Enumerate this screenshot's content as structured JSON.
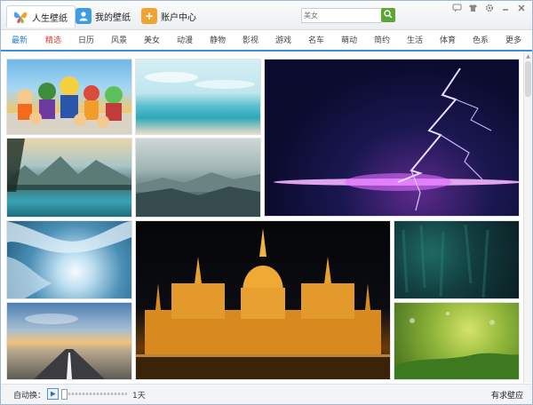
{
  "titlebar": {
    "tabs": [
      {
        "label": "人生壁纸",
        "icon": "butterfly-logo-icon",
        "active": true
      },
      {
        "label": "我的壁纸",
        "icon": "user-icon"
      },
      {
        "label": "账户中心",
        "icon": "plus-icon"
      }
    ],
    "search": {
      "placeholder": "美女",
      "value": ""
    },
    "window_buttons": [
      "message-icon",
      "shirt-skin-icon",
      "settings-icon",
      "minimize-icon",
      "close-icon"
    ]
  },
  "categories": {
    "items": [
      "最新",
      "精选",
      "日历",
      "风景",
      "美女",
      "动漫",
      "静物",
      "影视",
      "游戏",
      "名车",
      "萌动",
      "简约",
      "生活",
      "体育",
      "色系",
      "更多"
    ],
    "active": "最新",
    "highlighted": "精选"
  },
  "wallpapers": [
    {
      "name": "anime-characters"
    },
    {
      "name": "beach-sky"
    },
    {
      "name": "lightning-storm"
    },
    {
      "name": "mountain-lake"
    },
    {
      "name": "misty-hills"
    },
    {
      "name": "frosted-tree"
    },
    {
      "name": "parliament-night"
    },
    {
      "name": "dark-green-texture"
    },
    {
      "name": "road-sunset"
    },
    {
      "name": "green-bokeh"
    }
  ],
  "footer": {
    "auto_switch_label": "自动换：",
    "interval": "1天",
    "link": "有求壁应"
  },
  "colors": {
    "accent": "#3a8ee6",
    "hot": "#e23b2e",
    "search_button": "#5aa832"
  }
}
